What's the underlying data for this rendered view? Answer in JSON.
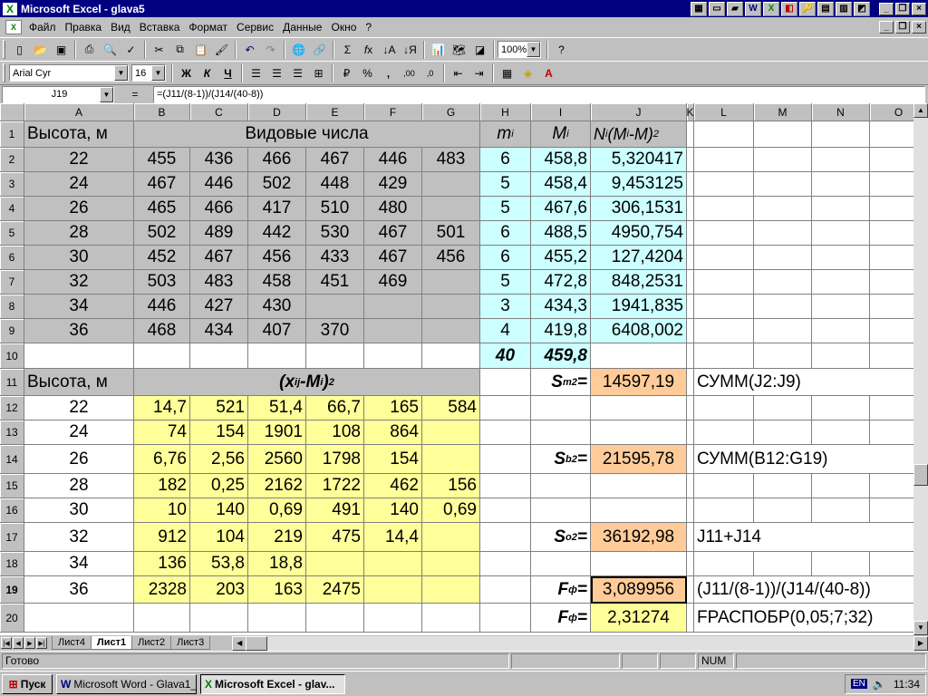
{
  "window": {
    "title": "Microsoft Excel - glava5"
  },
  "menu": [
    "Файл",
    "Правка",
    "Вид",
    "Вставка",
    "Формат",
    "Сервис",
    "Данные",
    "Окно",
    "?"
  ],
  "toolbar": {
    "zoom": "100%",
    "font": "Arial Cyr",
    "size": "16"
  },
  "formula_bar": {
    "name": "J19",
    "eq": "=",
    "formula": "=(J11/(8-1))/(J14/(40-8))"
  },
  "col_headers": [
    "A",
    "B",
    "C",
    "D",
    "E",
    "F",
    "G",
    "H",
    "I",
    "J",
    "K",
    "L",
    "M",
    "N",
    "O"
  ],
  "sheet": {
    "r1": {
      "a": "Высота, м",
      "b": "Видовые числа",
      "h": "m",
      "h_sub": "i",
      "i": "M",
      "i_sub": "i",
      "j": "N",
      "j_sub1": "i",
      "j_mid": "(M",
      "j_sub2": "i",
      "j_end": "-M)",
      "j_sup": "2"
    },
    "top_rows": [
      [
        "2",
        "22",
        "455",
        "436",
        "466",
        "467",
        "446",
        "483",
        "6",
        "458,8",
        "5,320417"
      ],
      [
        "3",
        "24",
        "467",
        "446",
        "502",
        "448",
        "429",
        "",
        "5",
        "458,4",
        "9,453125"
      ],
      [
        "4",
        "26",
        "465",
        "466",
        "417",
        "510",
        "480",
        "",
        "5",
        "467,6",
        "306,1531"
      ],
      [
        "5",
        "28",
        "502",
        "489",
        "442",
        "530",
        "467",
        "501",
        "6",
        "488,5",
        "4950,754"
      ],
      [
        "6",
        "30",
        "452",
        "467",
        "456",
        "433",
        "467",
        "456",
        "6",
        "455,2",
        "127,4204"
      ],
      [
        "7",
        "32",
        "503",
        "483",
        "458",
        "451",
        "469",
        "",
        "5",
        "472,8",
        "848,2531"
      ],
      [
        "8",
        "34",
        "446",
        "427",
        "430",
        "",
        "",
        "",
        "3",
        "434,3",
        "1941,835"
      ],
      [
        "9",
        "36",
        "468",
        "434",
        "407",
        "370",
        "",
        "",
        "4",
        "419,8",
        "6408,002"
      ]
    ],
    "r10": {
      "h": "40",
      "i": "459,8"
    },
    "r11": {
      "a": "Высота, м",
      "bg_head": "(x",
      "bg_sub1": "ij",
      "bg_mid": "-M",
      "bg_sub2": "i",
      "bg_end": ")",
      "bg_sup": "2",
      "i_s": "S",
      "i_sub": "m",
      "i_sup": "2",
      "i_eq": "=",
      "j": "14597,19",
      "l": "СУММ(J2:J9)"
    },
    "bottom_rows": [
      [
        "12",
        "22",
        "14,7",
        "521",
        "51,4",
        "66,7",
        "165",
        "584"
      ],
      [
        "13",
        "24",
        "74",
        "154",
        "1901",
        "108",
        "864",
        ""
      ],
      [
        "14",
        "26",
        "6,76",
        "2,56",
        "2560",
        "1798",
        "154",
        ""
      ],
      [
        "15",
        "28",
        "182",
        "0,25",
        "2162",
        "1722",
        "462",
        "156"
      ],
      [
        "16",
        "30",
        "10",
        "140",
        "0,69",
        "491",
        "140",
        "0,69"
      ],
      [
        "17",
        "32",
        "912",
        "104",
        "219",
        "475",
        "14,4",
        ""
      ],
      [
        "18",
        "34",
        "136",
        "53,8",
        "18,8",
        "",
        "",
        ""
      ],
      [
        "19",
        "36",
        "2328",
        "203",
        "163",
        "2475",
        "",
        ""
      ]
    ],
    "r14": {
      "i_s": "S",
      "i_sub": "b",
      "i_sup": "2",
      "i_eq": "=",
      "j": "21595,78",
      "l": "СУММ(B12:G19)"
    },
    "r17": {
      "i_s": "S",
      "i_sub": "o",
      "i_sup": "2",
      "i_eq": "=",
      "j": "36192,98",
      "l": "J11+J14"
    },
    "r19": {
      "i_s": "F",
      "i_sub": "ф",
      "i_eq": "=",
      "j": "3,089956",
      "l": "(J11/(8-1))/(J14/(40-8))"
    },
    "r20": {
      "i_s": "F",
      "i_sub": "ф",
      "i_eq": "=",
      "j": "2,31274",
      "l": "FРАСПОБР(0,05;7;32)"
    }
  },
  "tabs": [
    "Лист4",
    "Лист1",
    "Лист2",
    "Лист3"
  ],
  "status": {
    "ready": "Готово",
    "num": "NUM"
  },
  "taskbar": {
    "start": "Пуск",
    "task1": "Microsoft Word - Glava1_5",
    "task2": "Microsoft Excel - glav...",
    "lang": "EN",
    "clock": "11:34"
  }
}
